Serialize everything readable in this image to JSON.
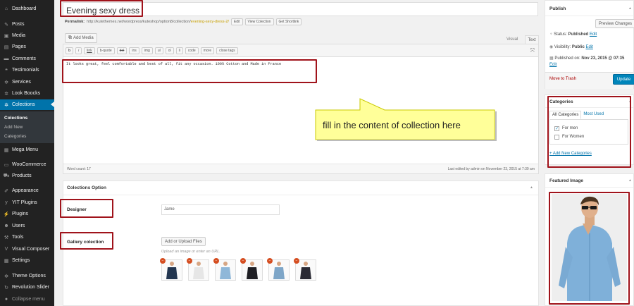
{
  "sidebar": {
    "items": [
      {
        "icon": "dashboard-icon",
        "glyph": "⌂",
        "label": "Dashboard"
      },
      {
        "icon": "pin-icon",
        "glyph": "✎",
        "label": "Posts"
      },
      {
        "icon": "media-icon",
        "glyph": "▣",
        "label": "Media"
      },
      {
        "icon": "pages-icon",
        "glyph": "▤",
        "label": "Pages"
      },
      {
        "icon": "comments-icon",
        "glyph": "▬",
        "label": "Comments"
      },
      {
        "icon": "quote-icon",
        "glyph": "❝",
        "label": "Testimonials"
      },
      {
        "icon": "gear-icon",
        "glyph": "✲",
        "label": "Services"
      },
      {
        "icon": "gear-icon",
        "glyph": "✲",
        "label": "Look Boocks"
      },
      {
        "icon": "gear-icon",
        "glyph": "✲",
        "label": "Colections"
      },
      {
        "icon": "megamenu-icon",
        "glyph": "▦",
        "label": "Mega Menu"
      },
      {
        "icon": "woocommerce-icon",
        "glyph": "▭",
        "label": "WooCommerce"
      },
      {
        "icon": "cart-icon",
        "glyph": "⛟",
        "label": "Products"
      },
      {
        "icon": "brush-icon",
        "glyph": "✐",
        "label": "Appearance"
      },
      {
        "icon": "yit-icon",
        "glyph": "y",
        "label": "YIT Plugins"
      },
      {
        "icon": "plugins-icon",
        "glyph": "⚡",
        "label": "Plugins"
      },
      {
        "icon": "users-icon",
        "glyph": "☻",
        "label": "Users"
      },
      {
        "icon": "wrench-icon",
        "glyph": "⚒",
        "label": "Tools"
      },
      {
        "icon": "visual-composer-icon",
        "glyph": "V",
        "label": "Visual Composer"
      },
      {
        "icon": "settings-icon",
        "glyph": "▦",
        "label": "Settings"
      },
      {
        "icon": "gear-icon",
        "glyph": "✲",
        "label": "Theme Options"
      },
      {
        "icon": "refresh-icon",
        "glyph": "↻",
        "label": "Revolution Slider"
      },
      {
        "icon": "collapse-icon",
        "glyph": "●",
        "label": "Collapse menu"
      }
    ],
    "submenu": [
      "Colections",
      "Add New",
      "Categories"
    ]
  },
  "post": {
    "title": "Evening sexy dress",
    "permalink_label": "Permalink:",
    "permalink_base": "http://kutethemes.net/wordpress/kuteshop/option8/collection/",
    "permalink_slug": "evening-sexy-dress-2/",
    "edit_btn": "Edit",
    "view_btn": "View Colection",
    "shortlink_btn": "Get Shortlink"
  },
  "editor": {
    "add_media": "Add Media",
    "tab_visual": "Visual",
    "tab_text": "Text",
    "quicktags": [
      "b",
      "i",
      "link",
      "b-quote",
      "del",
      "ins",
      "img",
      "ul",
      "ol",
      "li",
      "code",
      "more",
      "close tags"
    ],
    "content": "It looks great, feel comfortable and best of all, fit any occasion. 100% Cotton and Made in France",
    "word_count": "Word count: 17",
    "last_edited": "Last edited by admin on November 23, 2015 at 7:39 am"
  },
  "callout": {
    "text": "fill in the content of collection here"
  },
  "colections_option": {
    "title": "Colections Option",
    "designer_label": "Designer",
    "designer_value": "Jame",
    "gallery_label": "Gallery colection",
    "upload_btn": "Add or Upload Files",
    "upload_desc": "Upload an image or enter an URL.",
    "thumbs": [
      {
        "name": "gallery-thumb-navy-shirt",
        "color": "#233650"
      },
      {
        "name": "gallery-thumb-white-shirt",
        "color": "#e6e6e6"
      },
      {
        "name": "gallery-thumb-light-blue-shirt",
        "color": "#8fb7d8"
      },
      {
        "name": "gallery-thumb-black-dress",
        "color": "#1f1f24"
      },
      {
        "name": "gallery-thumb-blue-denim",
        "color": "#7ea6c8"
      },
      {
        "name": "gallery-thumb-dark-outfit",
        "color": "#2b2b35"
      }
    ]
  },
  "publish": {
    "title": "Publish",
    "preview_btn": "Preview Changes",
    "status_label": "Status:",
    "status_value": "Published",
    "status_edit": "Edit",
    "visibility_label": "Visibility:",
    "visibility_value": "Public",
    "visibility_edit": "Edit",
    "published_label": "Published on:",
    "published_value": "Nov 23, 2015 @ 07:35",
    "published_edit": "Edit",
    "trash": "Move to Trash",
    "update": "Update"
  },
  "categories": {
    "title": "Categories",
    "tab_all": "All Categories",
    "tab_used": "Most Used",
    "items": [
      {
        "label": "For men",
        "checked": true
      },
      {
        "label": "For Women",
        "checked": false
      }
    ],
    "add_new": "+ Add New Categories"
  },
  "featured_image": {
    "title": "Featured Image"
  },
  "colors": {
    "accent": "#0073aa",
    "highlight_border": "#a0131b",
    "callout_fill": "#ffff99",
    "admin_bar": "#222222"
  }
}
